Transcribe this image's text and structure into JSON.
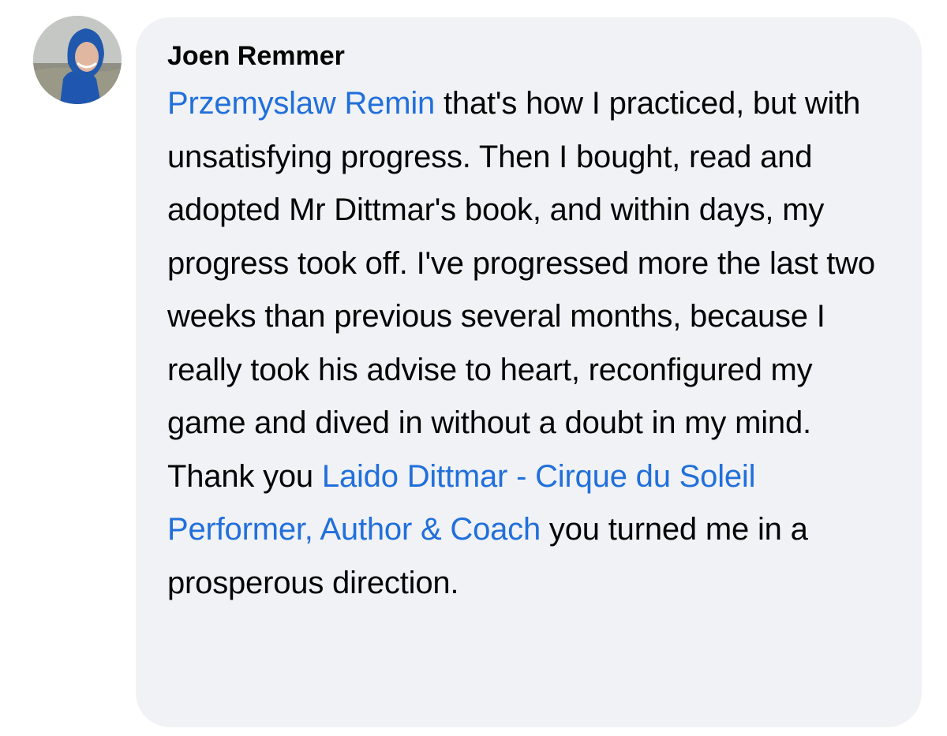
{
  "comment": {
    "author": "Joen Remmer",
    "mention_1": "Przemyslaw Remin",
    "text_1": " that's how I practiced, but with unsatisfying progress. Then I bought, read and adopted Mr Dittmar's book, and within days, my progress took off. I've progressed more the last two weeks than previous several months, because I really took his advise to heart, reconfigured my game and dived in without a doubt in my mind. Thank you ",
    "mention_2": "Laido Dittmar - Cirque du Soleil Performer, Author & Coach",
    "text_2": " you turned me in a prosperous direction."
  },
  "colors": {
    "bubble_background": "#f0f2f5",
    "mention_link": "#216fdb",
    "text": "#050505"
  }
}
